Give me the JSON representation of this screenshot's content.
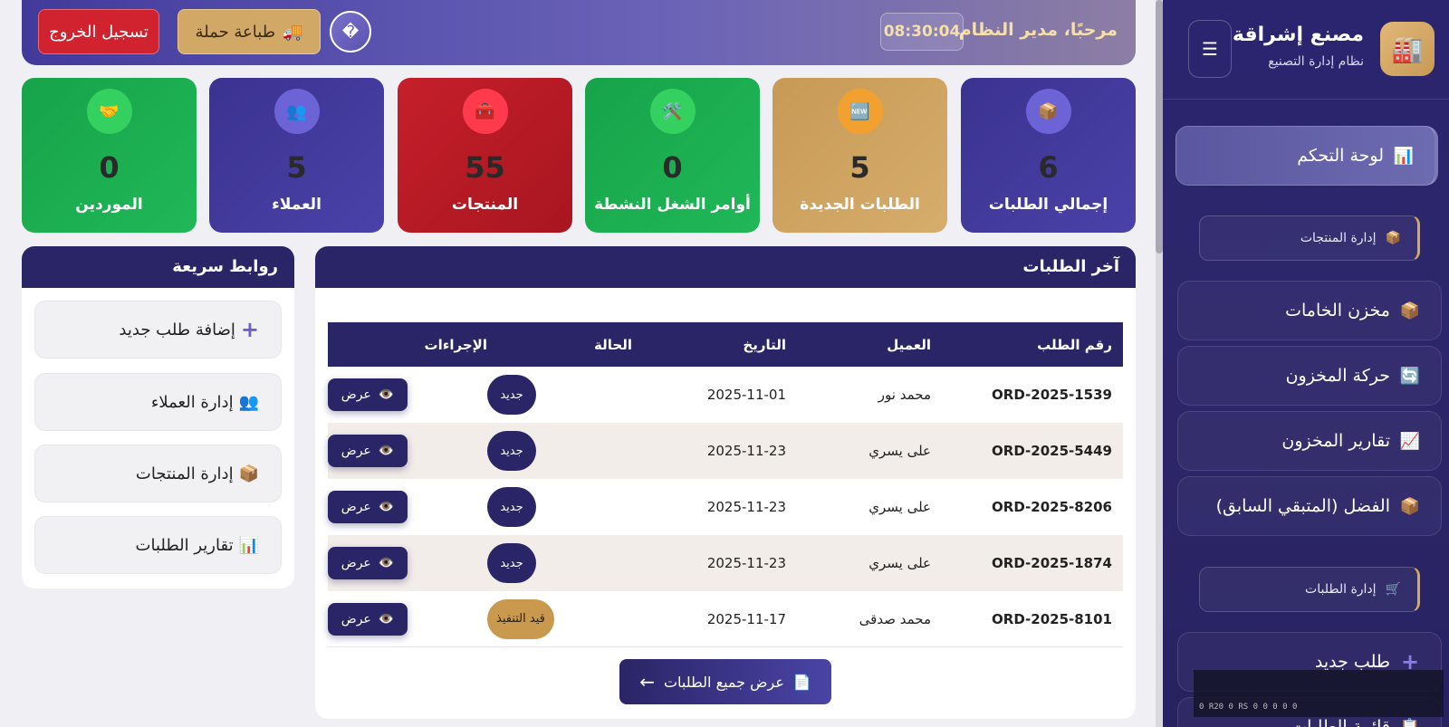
{
  "brand": {
    "title": "مصنع إشراقة",
    "subtitle": "نظام إدارة التصنيع",
    "logo_icon": "🏭",
    "menu_icon": "☰"
  },
  "sidebar": {
    "items": [
      {
        "label": "لوحة التحكم",
        "icon": "📊"
      },
      {
        "label": "إدارة المنتجات",
        "icon": "📦"
      },
      {
        "label": "مخزن الخامات",
        "icon": "📦"
      },
      {
        "label": "حركة المخزون",
        "icon": "🔄"
      },
      {
        "label": "تقارير المخزون",
        "icon": "📈"
      },
      {
        "label": "الفضل (المتبقي السابق)",
        "icon": "📦"
      },
      {
        "label": "إدارة الطلبات",
        "icon": "🛒"
      },
      {
        "label": "طلب جديد",
        "icon": "+"
      },
      {
        "label": "قائمة الطلبات",
        "icon": "📋"
      }
    ]
  },
  "overlay_text": "0 R20 0 RS 0 0 0 0 0",
  "topbar": {
    "welcome": "مرحبًا، مدير النظام",
    "clock": "08:30:04",
    "logout_label": "تسجيل الخروج",
    "print_label": "طباعة حملة",
    "print_icon": "🚚",
    "circle_icon": "�"
  },
  "stats": [
    {
      "label": "إجمالي الطلبات",
      "value": "6",
      "icon": "📦"
    },
    {
      "label": "الطلبات الجديدة",
      "value": "5",
      "icon": "🆕"
    },
    {
      "label": "أوامر الشغل النشطة",
      "value": "0",
      "icon": "🛠️"
    },
    {
      "label": "المنتجات",
      "value": "55",
      "icon": "🧰"
    },
    {
      "label": "العملاء",
      "value": "5",
      "icon": "👥"
    },
    {
      "label": "الموردين",
      "value": "0",
      "icon": "🤝"
    }
  ],
  "orders": {
    "title": "آخر الطلبات",
    "headers": [
      "رقم الطلب",
      "العميل",
      "التاريخ",
      "الحالة",
      "الإجراءات"
    ],
    "rows": [
      {
        "id": "ORD-2025-1539",
        "customer": "محمد نور",
        "date": "2025-11-01",
        "status": "جديد"
      },
      {
        "id": "ORD-2025-5449",
        "customer": "على يسري",
        "date": "2025-11-23",
        "status": "جديد"
      },
      {
        "id": "ORD-2025-8206",
        "customer": "على يسري",
        "date": "2025-11-23",
        "status": "جديد"
      },
      {
        "id": "ORD-2025-1874",
        "customer": "على يسري",
        "date": "2025-11-23",
        "status": "جديد"
      },
      {
        "id": "ORD-2025-8101",
        "customer": "محمد صدقى",
        "date": "2025-11-17",
        "status": "قيد التنفيذ"
      }
    ],
    "view_label": "عرض",
    "view_icon": "👁️",
    "all_label": "عرض جميع الطلبات",
    "all_icon": "📄",
    "all_arrow": "←"
  },
  "quick_links": {
    "title": "روابط سريعة",
    "items": [
      {
        "label": "إضافة طلب جديد",
        "icon": "+"
      },
      {
        "label": "إدارة العملاء",
        "icon": "👥"
      },
      {
        "label": "إدارة المنتجات",
        "icon": "📦"
      },
      {
        "label": "تقارير الطلبات",
        "icon": "📊"
      }
    ]
  },
  "colors": {
    "primary": "#2a2566",
    "gold": "#d2a866",
    "danger": "#d0232f",
    "success": "#1faa4f",
    "purple": "#3e3594"
  }
}
